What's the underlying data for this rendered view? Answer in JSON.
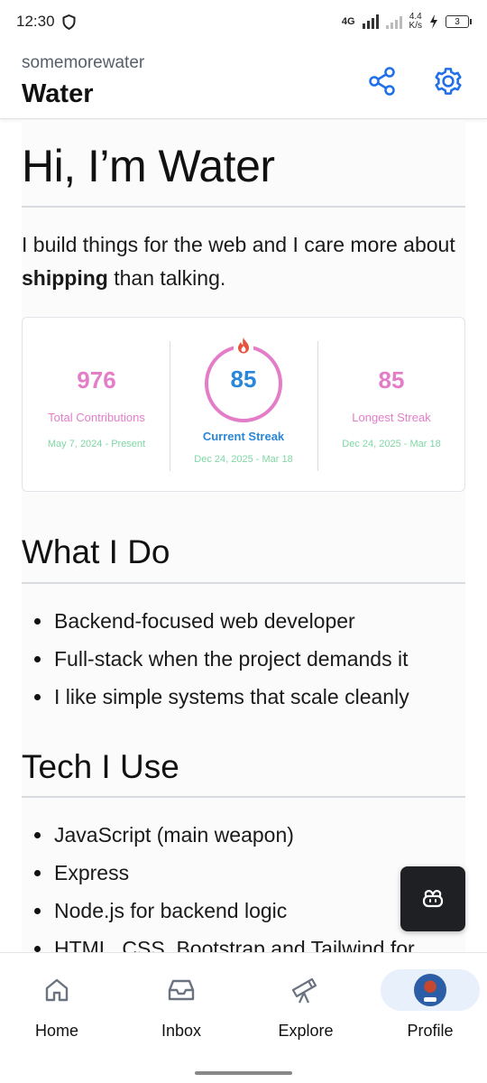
{
  "status_bar": {
    "time": "12:30",
    "network": "4G",
    "speed_value": "4.4",
    "speed_unit": "K/s",
    "battery": "3"
  },
  "header": {
    "owner": "somemorewater",
    "repo": "Water",
    "share_icon": "share-icon",
    "settings_icon": "gear-icon"
  },
  "readme": {
    "heading": "Hi, I’m Water",
    "intro_before": "I build things for the web and I care more about ",
    "intro_bold": "shipping",
    "intro_after": " than talking.",
    "stats": {
      "total": {
        "value": "976",
        "label": "Total Contributions",
        "range": "May 7, 2024 - Present"
      },
      "current": {
        "value": "85",
        "label": "Current Streak",
        "range": "Dec 24, 2025 - Mar 18"
      },
      "longest": {
        "value": "85",
        "label": "Longest Streak",
        "range": "Dec 24, 2025 - Mar 18"
      },
      "colors": {
        "accent_pink": "#e37dc8",
        "accent_blue": "#2a86d9",
        "accent_green": "#7fd7a4"
      }
    },
    "what_i_do": {
      "heading": "What I Do",
      "items": [
        "Backend-focused web developer",
        "Full-stack when the project demands it",
        "I like simple systems that scale cleanly"
      ]
    },
    "tech": {
      "heading": "Tech I Use",
      "items": [
        "JavaScript (main weapon)",
        "Express",
        "Node.js for backend logic",
        "HTML, CSS, Bootstrap and Tailwind for"
      ]
    }
  },
  "fab": {
    "icon": "copilot-icon"
  },
  "bottom_nav": {
    "items": [
      {
        "label": "Home",
        "icon": "home-icon"
      },
      {
        "label": "Inbox",
        "icon": "inbox-icon"
      },
      {
        "label": "Explore",
        "icon": "telescope-icon"
      },
      {
        "label": "Profile",
        "icon": "avatar"
      }
    ],
    "active": "Profile"
  }
}
